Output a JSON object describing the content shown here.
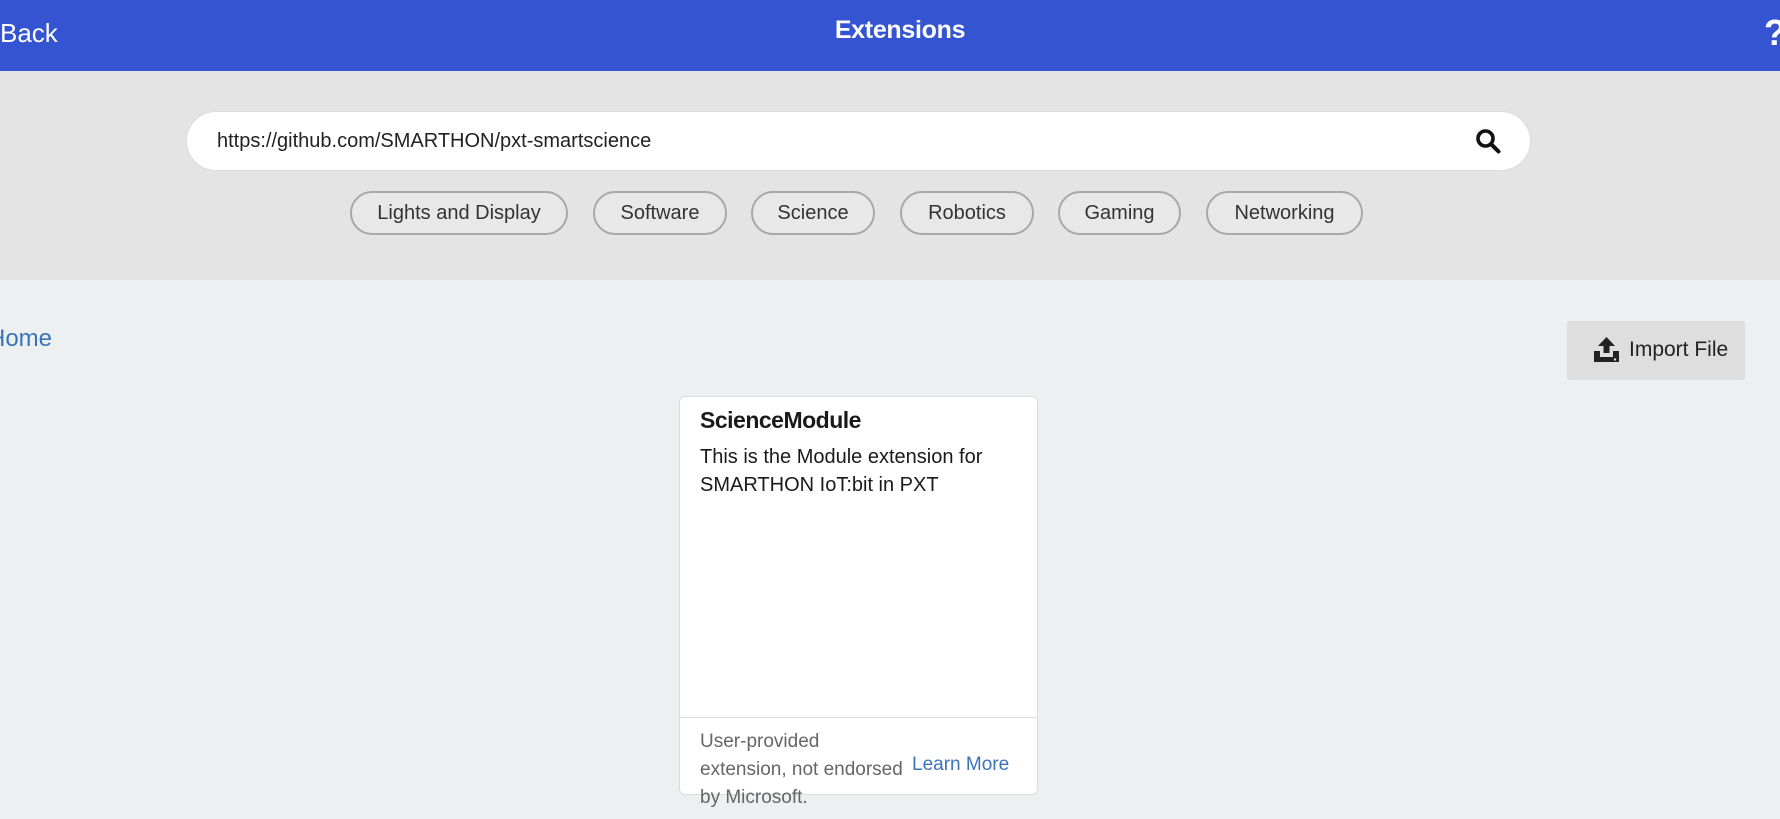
{
  "header": {
    "back_label": "Back",
    "title": "Extensions",
    "help_glyph": "?",
    "background_color": "#3454d1"
  },
  "search": {
    "value": "https://github.com/SMARTHON/pxt-smartscience",
    "icon": "search-icon"
  },
  "tags": [
    {
      "label": "Lights and Display"
    },
    {
      "label": "Software"
    },
    {
      "label": "Science"
    },
    {
      "label": "Robotics"
    },
    {
      "label": "Gaming"
    },
    {
      "label": "Networking"
    }
  ],
  "breadcrumb": {
    "home_label": "Home"
  },
  "import": {
    "label": "Import File",
    "icon": "upload-icon"
  },
  "results": [
    {
      "title": "ScienceModule",
      "description": "This is the Module extension for SMARTHON IoT:bit in PXT",
      "footer_text": "User-provided extension, not endorsed by Microsoft.",
      "learn_more_label": "Learn More"
    }
  ]
}
